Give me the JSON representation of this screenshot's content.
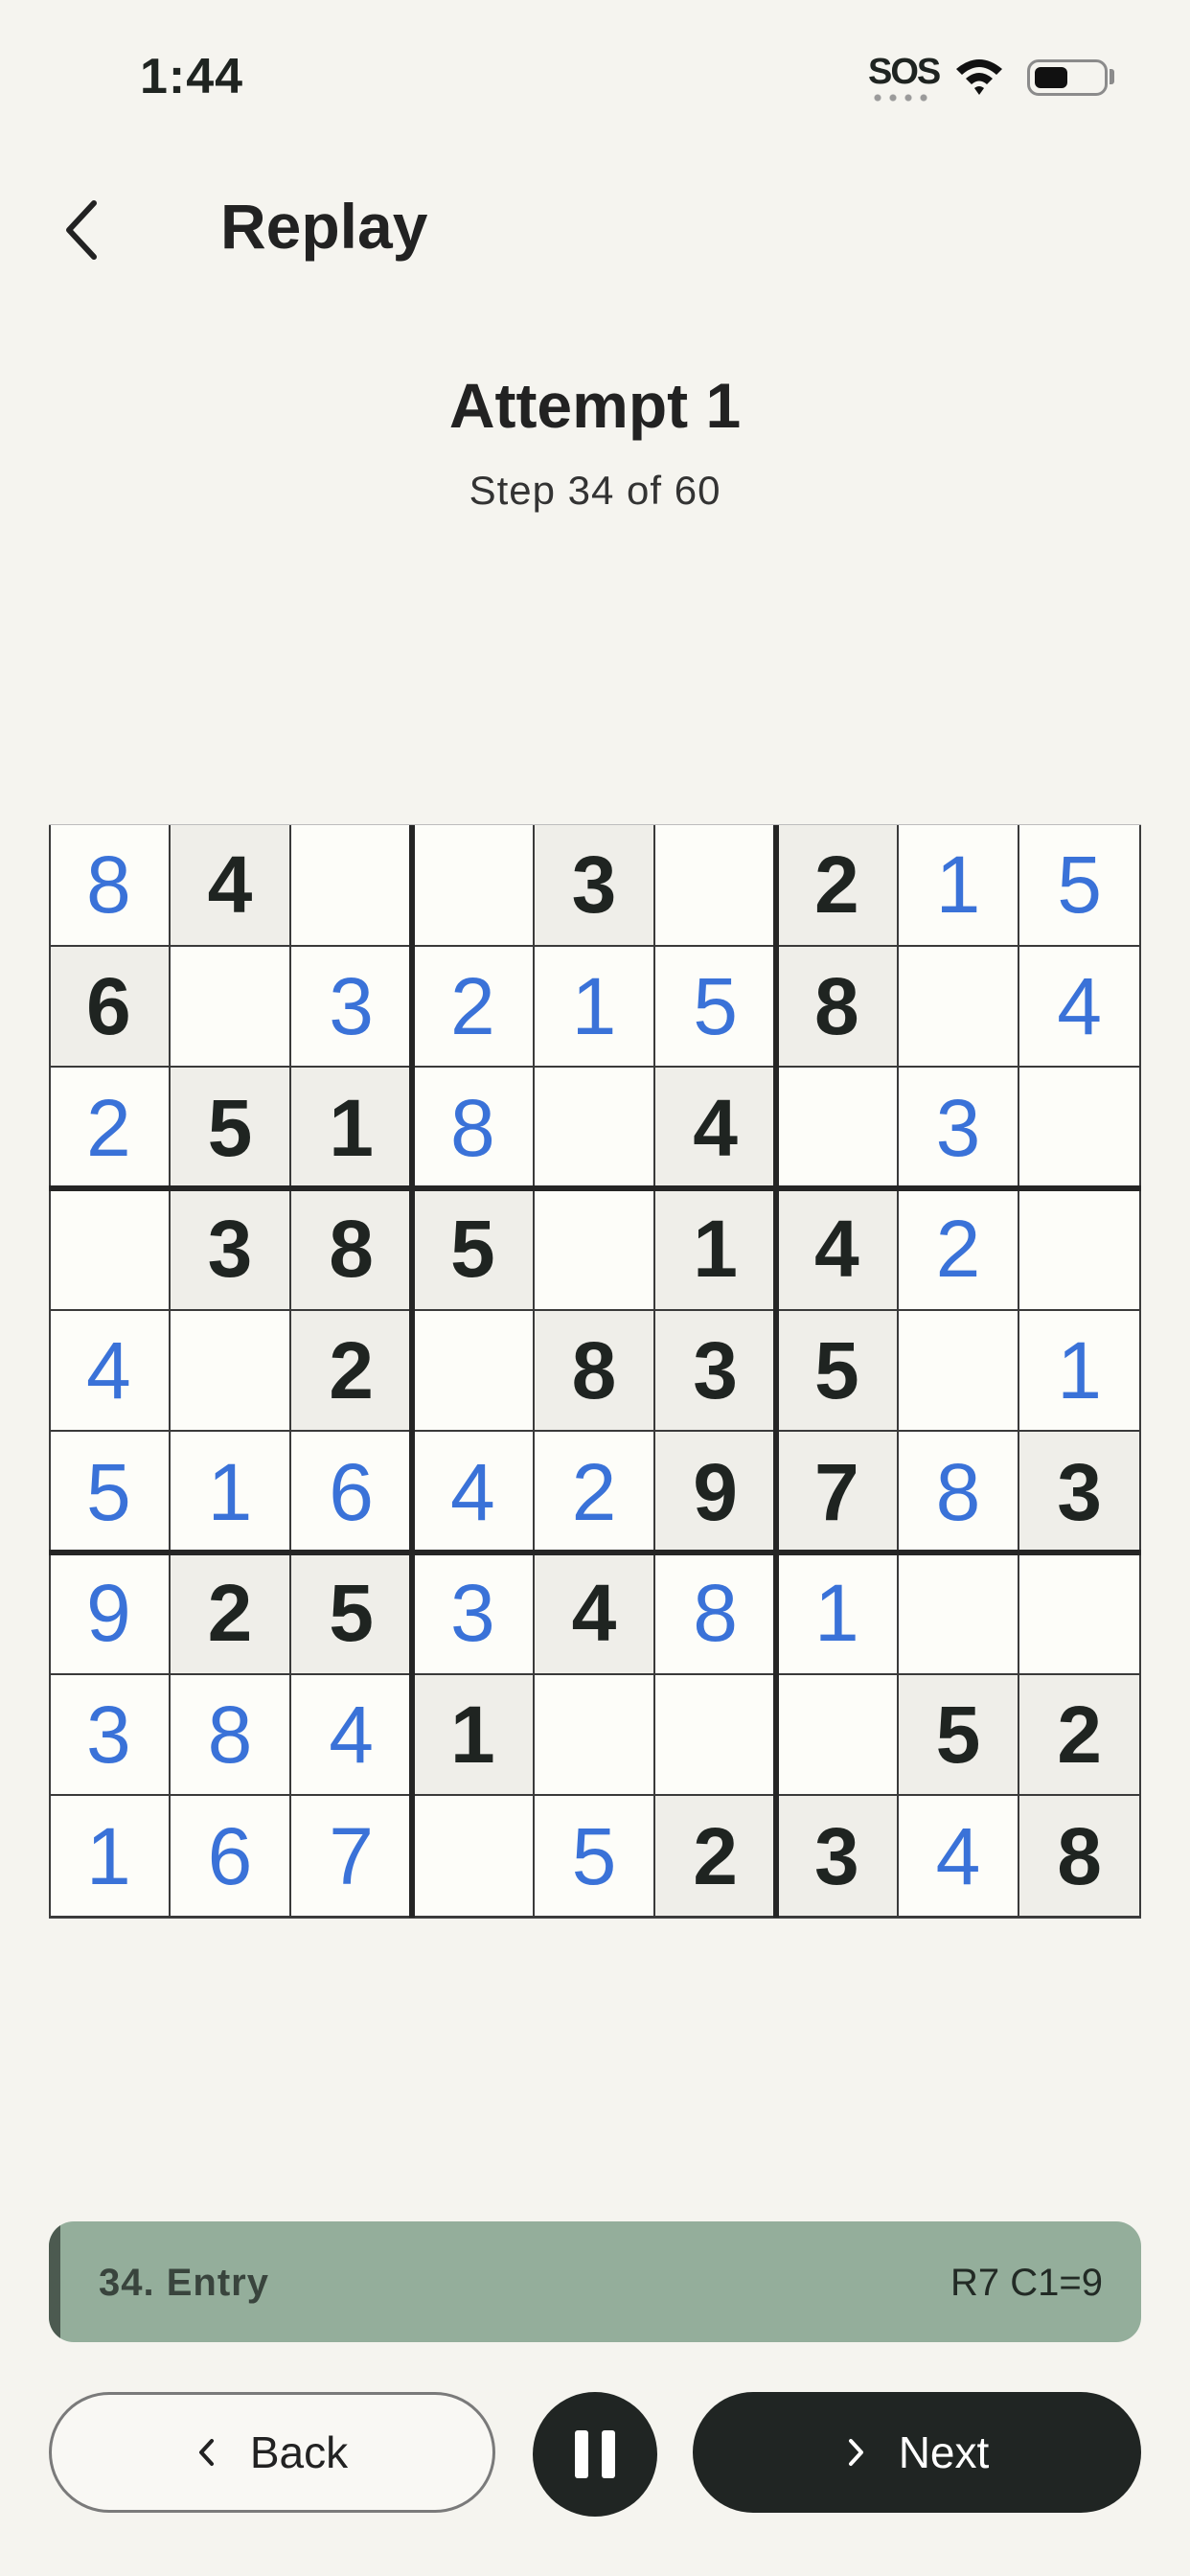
{
  "status_bar": {
    "time": "1:44",
    "sos": "SOS"
  },
  "header": {
    "title": "Replay"
  },
  "attempt": {
    "title": "Attempt 1",
    "step": "Step 34 of 60"
  },
  "board": {
    "cells": [
      [
        "8u",
        "4g",
        "",
        "",
        "3g",
        "",
        "2g",
        "1u",
        "5u"
      ],
      [
        "6g",
        "",
        "3u",
        "2u",
        "1u",
        "5u",
        "8g",
        "",
        "4u"
      ],
      [
        "2u",
        "5g",
        "1g",
        "8u",
        "",
        "4g",
        "",
        "3u",
        ""
      ],
      [
        "",
        "3g",
        "8g",
        "5g",
        "",
        "1g",
        "4g",
        "2u",
        ""
      ],
      [
        "4u",
        "",
        "2g",
        "",
        "8g",
        "3g",
        "5g",
        "",
        "1u"
      ],
      [
        "5u",
        "1u",
        "6u",
        "4u",
        "2u",
        "9g",
        "7g",
        "8u",
        "3g"
      ],
      [
        "9u",
        "2g",
        "5g",
        "3u",
        "4g",
        "8u",
        "1u",
        "",
        ""
      ],
      [
        "3u",
        "8u",
        "4u",
        "1g",
        "",
        "",
        "",
        "5g",
        "2g"
      ],
      [
        "1u",
        "6u",
        "7u",
        "",
        "5u",
        "2g",
        "3g",
        "4u",
        "8g"
      ]
    ]
  },
  "move": {
    "step_label": "34. Entry",
    "coord": "R7 C1=9"
  },
  "controls": {
    "back_label": "Back",
    "next_label": "Next"
  }
}
